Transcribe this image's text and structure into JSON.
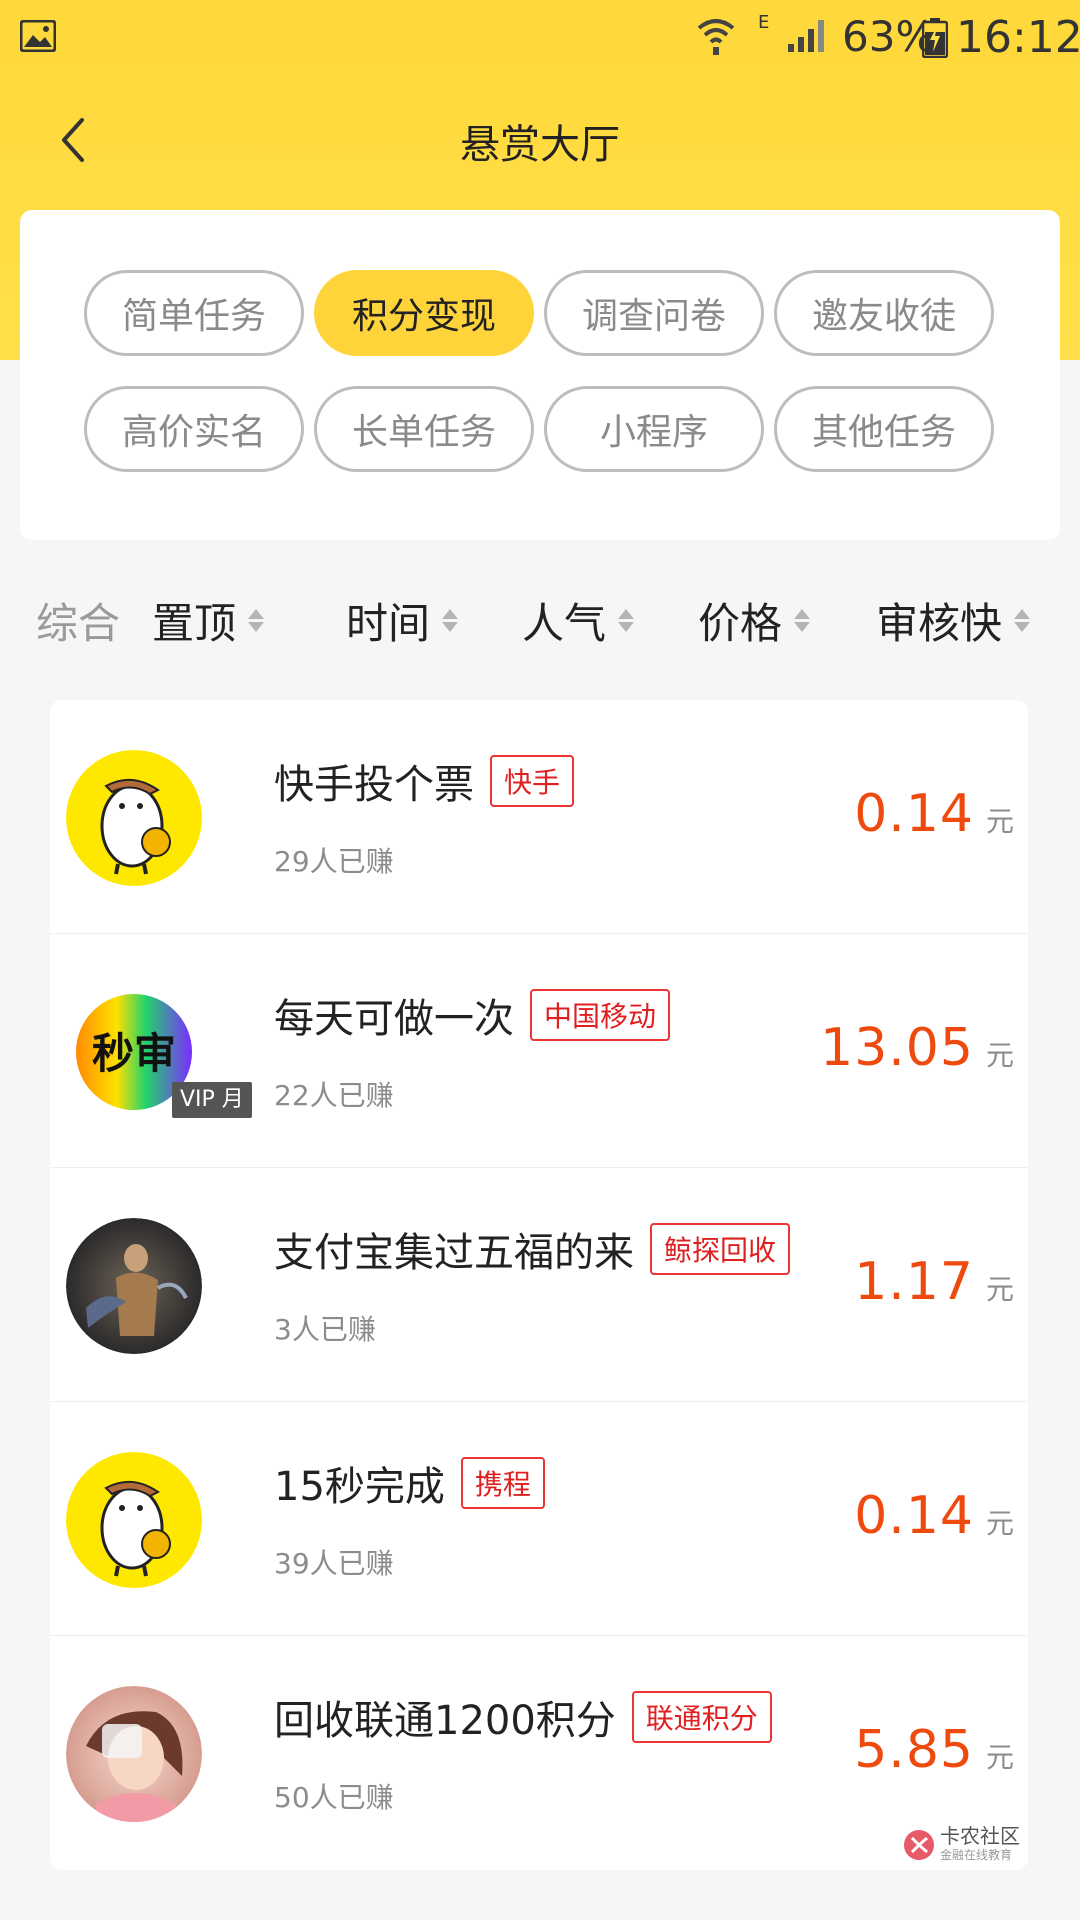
{
  "status_bar": {
    "battery": "63%",
    "time": "16:12",
    "network": "E"
  },
  "nav": {
    "title": "悬赏大厅",
    "back_icon": "chevron-left-icon"
  },
  "categories": [
    {
      "label": "简单任务",
      "active": false
    },
    {
      "label": "积分变现",
      "active": true
    },
    {
      "label": "调查问卷",
      "active": false
    },
    {
      "label": "邀友收徒",
      "active": false
    },
    {
      "label": "高价实名",
      "active": false
    },
    {
      "label": "长单任务",
      "active": false
    },
    {
      "label": "小程序",
      "active": false
    },
    {
      "label": "其他任务",
      "active": false
    }
  ],
  "sort": {
    "general": "综合",
    "items": [
      "置顶",
      "时间",
      "人气",
      "价格",
      "审核快"
    ]
  },
  "tasks": [
    {
      "title": "快手投个票",
      "tag": "快手",
      "earned": "29人已赚",
      "price": "0.14",
      "unit": "元",
      "avatar": "egg-mascot"
    },
    {
      "title": "每天可做一次",
      "tag": "中国移动",
      "earned": "22人已赚",
      "price": "13.05",
      "unit": "元",
      "avatar": "miaoshen",
      "avatar_text": "秒审",
      "vip": "VIP 月"
    },
    {
      "title": "支付宝集过五福的来",
      "tag": "鲸探回收",
      "earned": "3人已赚",
      "price": "1.17",
      "unit": "元",
      "avatar": "art-figure"
    },
    {
      "title": "15秒完成",
      "tag": "携程",
      "earned": "39人已赚",
      "price": "0.14",
      "unit": "元",
      "avatar": "egg-mascot"
    },
    {
      "title": "回收联通1200积分",
      "tag": "联通积分",
      "earned": "50人已赚",
      "price": "5.85",
      "unit": "元",
      "avatar": "girl-photo"
    }
  ],
  "watermark": {
    "title": "卡农社区",
    "subtitle": "金融在线教育"
  },
  "colors": {
    "accent": "#ffd43b",
    "price": "#ee4a0e",
    "tag": "#e02020"
  }
}
